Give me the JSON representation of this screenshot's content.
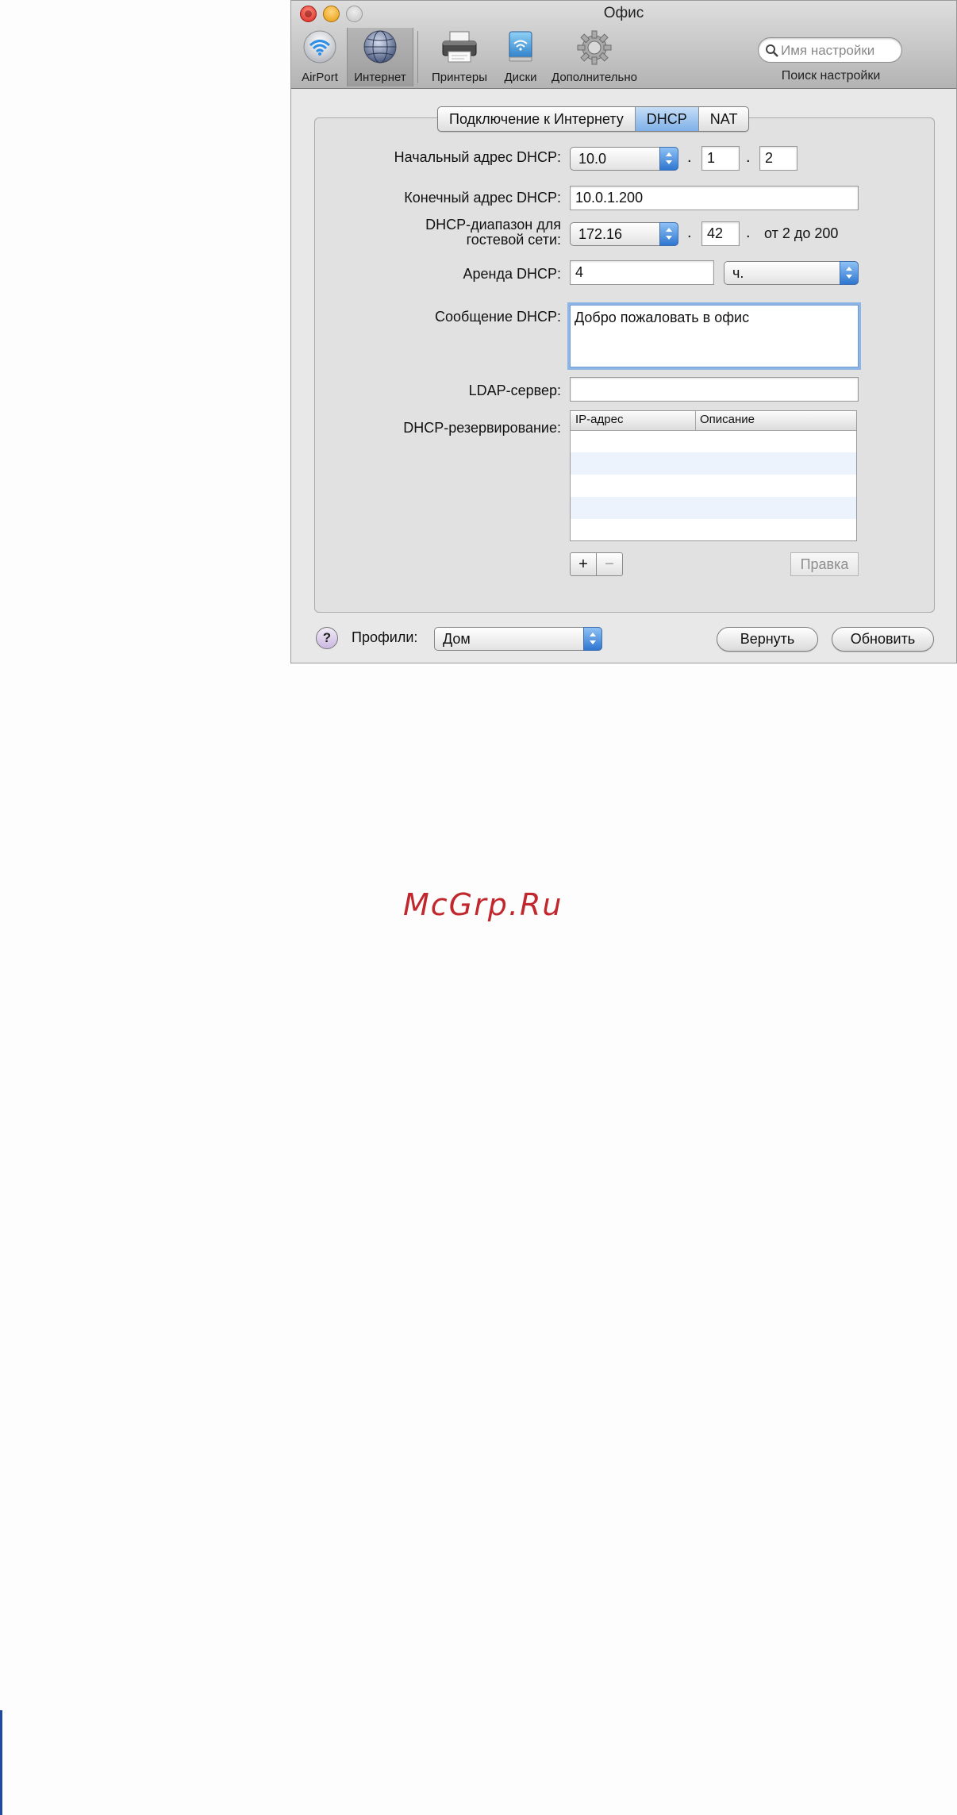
{
  "window": {
    "title": "Офис"
  },
  "toolbar": {
    "items": [
      {
        "label": "AirPort",
        "icon": "airport-wifi-icon"
      },
      {
        "label": "Интернет",
        "icon": "globe-icon",
        "selected": true
      },
      {
        "label": "Принтеры",
        "icon": "printer-icon"
      },
      {
        "label": "Диски",
        "icon": "disk-icon"
      },
      {
        "label": "Дополнительно",
        "icon": "gear-icon"
      }
    ],
    "search": {
      "placeholder": "Имя настройки",
      "caption": "Поиск настройки"
    }
  },
  "tabs": [
    {
      "label": "Подключение к Интернету",
      "active": false
    },
    {
      "label": "DHCP",
      "active": true
    },
    {
      "label": "NAT",
      "active": false
    }
  ],
  "form": {
    "start_label": "Начальный адрес DHCP:",
    "start_prefix": "10.0",
    "start_octet3": "1",
    "start_octet4": "2",
    "end_label": "Конечный адрес DHCP:",
    "end_value": "10.0.1.200",
    "guest_label_line1": "DHCP-диапазон для",
    "guest_label_line2": "гостевой сети:",
    "guest_prefix": "172.16",
    "guest_octet3": "42",
    "guest_range_text": "от 2 до 200",
    "lease_label": "Аренда DHCP:",
    "lease_value": "4",
    "lease_unit": "ч.",
    "message_label": "Сообщение DHCP:",
    "message_value": "Добро пожаловать в офис",
    "ldap_label": "LDAP-сервер:",
    "ldap_value": "",
    "reservation_label": "DHCP-резервирование:",
    "reservation_table": {
      "columns": [
        "IP-адрес",
        "Описание"
      ],
      "rows": []
    },
    "add_label": "+",
    "remove_label": "−",
    "edit_label": "Правка"
  },
  "footer": {
    "help_label": "?",
    "profiles_label": "Профили:",
    "profile_value": "Дом",
    "revert_label": "Вернуть",
    "update_label": "Обновить"
  },
  "watermark": "McGrp.Ru",
  "colors": {
    "accent": "#3f7fd6",
    "watermark": "#c0282e"
  }
}
